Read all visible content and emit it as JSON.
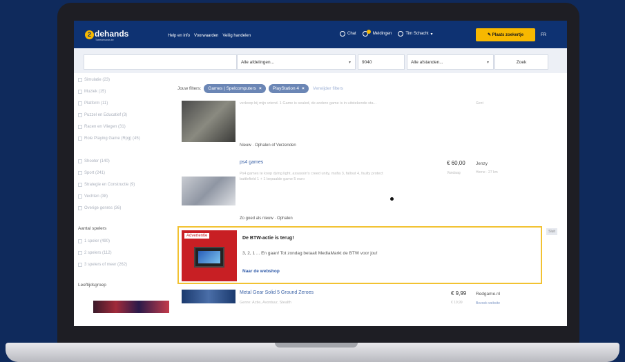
{
  "header": {
    "logo": "2dehands",
    "logo_digit": "2",
    "logo_rest": "dehands",
    "logo_sub": "Tweedehands.be",
    "nav_links": [
      "Help en info",
      "Voorwaarden",
      "Veilig handelen"
    ],
    "chat": "Chat",
    "notifications": "Meldingen",
    "user": "Tim Schacht",
    "place_ad": "Plaats zoekertje",
    "lang": "FR"
  },
  "search": {
    "query": "",
    "category": "Alle afdelingen...",
    "postcode": "9040",
    "distance": "Alle afstanden...",
    "button": "Zoek"
  },
  "sidebar": {
    "categories": [
      "Simulatie (23)",
      "Muziek (15)",
      "Platform (11)",
      "Puzzel en Educatief (3)",
      "Racen en Vliegen (31)",
      "Role Playing Game (Rpg) (45)",
      "Shooter (140)",
      "Sport (241)",
      "Strategie en Constructie (9)",
      "Vechten (38)",
      "Overige genres (36)"
    ],
    "players_heading": "Aantal spelers",
    "players": [
      "1 speler (490)",
      "2 spelers (112)",
      "3 spelers of meer (262)"
    ],
    "age_heading": "Leeftijdsgroep"
  },
  "filters": {
    "label": "Jouw filters:",
    "chips": [
      "Games | Spelcomputers",
      "PlayStation 4"
    ],
    "clear": "Verwijder filters"
  },
  "listings": [
    {
      "title": "",
      "desc": "verkoop bij mijn vriend. 1 Game is sealed, de andere game is in uitstekende sta...",
      "meta": "Nieuw · Ophalen of Verzenden",
      "price": "",
      "price_sub": "",
      "seller": "",
      "seller_sub": "Gent"
    },
    {
      "title": "ps4 games",
      "desc": "Ps4 games te koop dying light, assassin's creed unity, mafia 3, fallout 4, faulty protect battlefield 1 + 1 bepaalde game 5 euro",
      "meta": "Zo goed als nieuw · Ophalen",
      "price": "€ 60,00",
      "price_sub": "Vandaag",
      "seller": "Jenzy",
      "seller_sub": "Herne · 27 km"
    },
    {
      "title": "Metal Gear Solid 5 Ground Zeroes",
      "desc": "Genre: Actie, Avontuur, Stealth",
      "meta": "",
      "price": "€ 9,99",
      "price_sub": "€ 19,99",
      "seller": "Redgame.nl",
      "seller_sub": "Bezoek website"
    }
  ],
  "ad": {
    "label": "Advertentie",
    "title": "De BTW-actie is terug!",
    "text": "3, 2, 1 ... En gaan! Tot zondag betaalt MediaMarkt de BTW voor jou!",
    "link": "Naar de webshop",
    "close": "Sluit"
  },
  "colors": {
    "brand_blue": "#0e3272",
    "accent_yellow": "#f7b800",
    "chip_blue": "#6b86b5",
    "ad_red": "#c81f24"
  }
}
